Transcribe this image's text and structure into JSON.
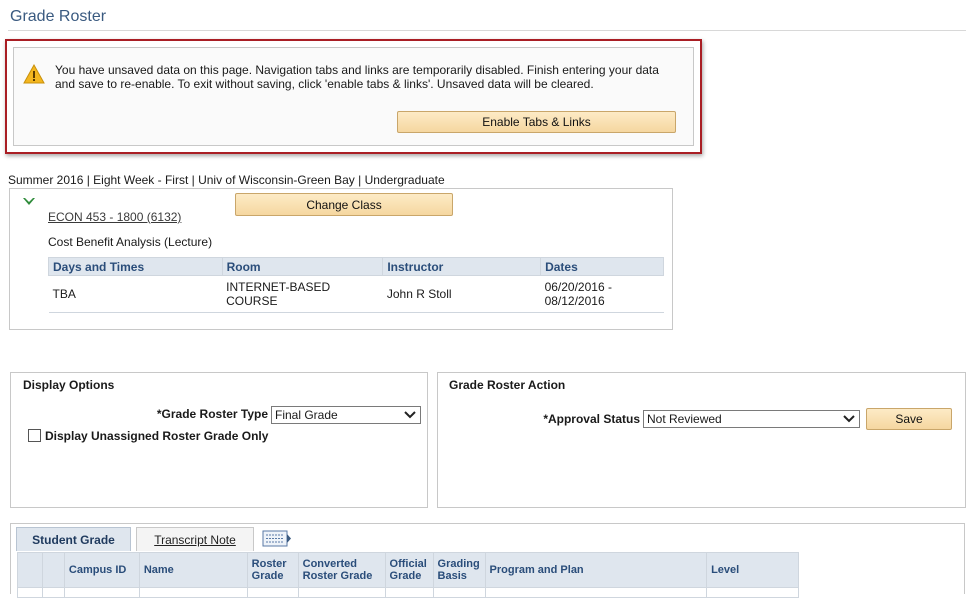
{
  "page": {
    "title": "Grade Roster"
  },
  "warning": {
    "text": "You have unsaved data on this page. Navigation tabs and links are temporarily disabled. Finish entering your data and save to re-enable. To exit without saving, click 'enable tabs & links'. Unsaved data will be cleared.",
    "button_label": "Enable Tabs & Links",
    "icon": "warning-icon"
  },
  "class_info": {
    "term_line": "Summer 2016 | Eight Week - First | Univ of Wisconsin-Green Bay | Undergraduate",
    "class_link": "ECON 453 - 1800 (6132)",
    "change_button": "Change Class",
    "course_title": "Cost Benefit Analysis (Lecture)",
    "meeting_headers": [
      "Days and Times",
      "Room",
      "Instructor",
      "Dates"
    ],
    "meeting_rows": [
      {
        "days": "TBA",
        "room": "INTERNET-BASED COURSE",
        "instructor": "John R Stoll",
        "dates": "06/20/2016 - 08/12/2016"
      }
    ]
  },
  "display_options": {
    "title": "Display Options",
    "roster_type_label": "*Grade Roster Type",
    "roster_type_value": "Final Grade",
    "unassigned_label": "Display Unassigned Roster Grade Only"
  },
  "roster_action": {
    "title": "Grade Roster Action",
    "approval_label": "*Approval Status",
    "approval_value": "Not Reviewed",
    "save_button": "Save"
  },
  "grid": {
    "tabs": [
      {
        "label": "Student Grade",
        "active": true
      },
      {
        "label": "Transcript Note",
        "active": false
      }
    ],
    "columns": [
      "",
      "",
      "Campus ID",
      "Name",
      "Roster Grade",
      "Converted Roster Grade",
      "Official Grade",
      "Grading Basis",
      "Program and Plan",
      "Level"
    ]
  },
  "colors": {
    "header_blue": "#3a5a80",
    "warning_border": "#a91e24",
    "button_fill": "#f5d7a0",
    "grid_header_bg": "#dfe6ee"
  }
}
